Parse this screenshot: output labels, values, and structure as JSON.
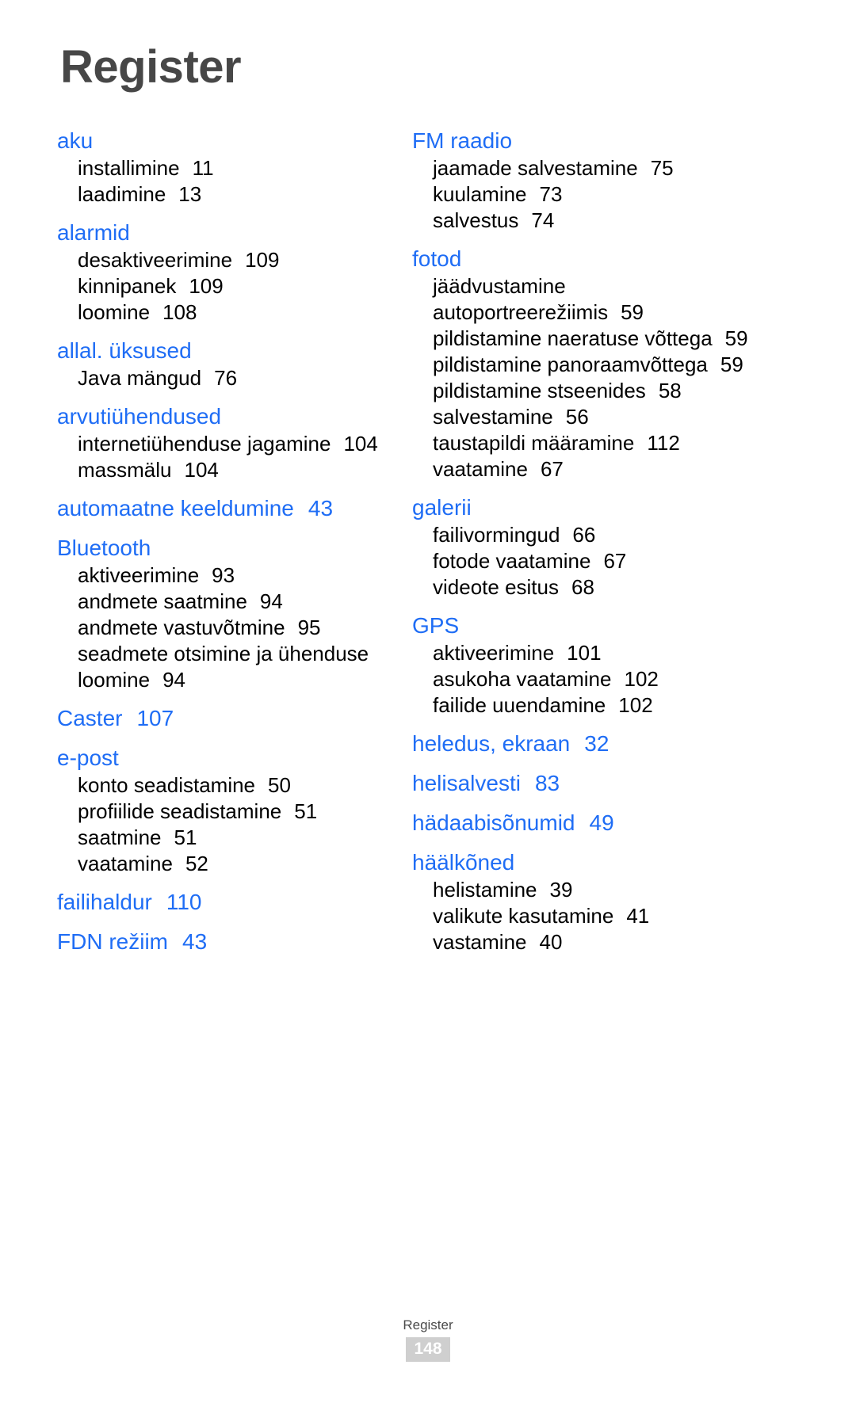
{
  "page": {
    "title": "Register",
    "footer_label": "Register",
    "footer_pagenum": "148",
    "accent_color": "#1f6df5",
    "title_color": "#474747",
    "pagenum_bg": "#cfcfcf"
  },
  "columns": [
    {
      "id": "left",
      "groups": [
        {
          "term": "aku",
          "term_page": "",
          "subs": [
            {
              "label": "installimine",
              "page": "11"
            },
            {
              "label": "laadimine",
              "page": "13"
            }
          ]
        },
        {
          "term": "alarmid",
          "term_page": "",
          "subs": [
            {
              "label": "desaktiveerimine",
              "page": "109"
            },
            {
              "label": "kinnipanek",
              "page": "109"
            },
            {
              "label": "loomine",
              "page": "108"
            }
          ]
        },
        {
          "term": "allal. üksused",
          "term_page": "",
          "subs": [
            {
              "label": "Java mängud",
              "page": "76"
            }
          ]
        },
        {
          "term": "arvutiühendused",
          "term_page": "",
          "subs": [
            {
              "label": "internetiühenduse jagamine",
              "page": "104"
            },
            {
              "label": "massmälu",
              "page": "104"
            }
          ]
        },
        {
          "term": "automaatne keeldumine",
          "term_page": "43",
          "subs": []
        },
        {
          "term": "Bluetooth",
          "term_page": "",
          "subs": [
            {
              "label": "aktiveerimine",
              "page": "93"
            },
            {
              "label": "andmete saatmine",
              "page": "94"
            },
            {
              "label": "andmete vastuvõtmine",
              "page": "95"
            },
            {
              "label": "seadmete otsimine ja ühenduse loomine",
              "page": "94"
            }
          ]
        },
        {
          "term": "Caster",
          "term_page": "107",
          "subs": []
        },
        {
          "term": "e-post",
          "term_page": "",
          "subs": [
            {
              "label": "konto seadistamine",
              "page": "50"
            },
            {
              "label": "profiilide seadistamine",
              "page": "51"
            },
            {
              "label": "saatmine",
              "page": "51"
            },
            {
              "label": "vaatamine",
              "page": "52"
            }
          ]
        },
        {
          "term": "failihaldur",
          "term_page": "110",
          "subs": []
        },
        {
          "term": "FDN režiim",
          "term_page": "43",
          "subs": []
        }
      ]
    },
    {
      "id": "right",
      "groups": [
        {
          "term": "FM raadio",
          "term_page": "",
          "subs": [
            {
              "label": "jaamade salvestamine",
              "page": "75"
            },
            {
              "label": "kuulamine",
              "page": "73"
            },
            {
              "label": "salvestus",
              "page": "74"
            }
          ]
        },
        {
          "term": "fotod",
          "term_page": "",
          "subs": [
            {
              "label": "jäädvustamine autoportreerežiimis",
              "page": "59"
            },
            {
              "label": "pildistamine naeratuse võttega",
              "page": "59"
            },
            {
              "label": "pildistamine panoraamvõttega",
              "page": "59"
            },
            {
              "label": "pildistamine stseenides",
              "page": "58"
            },
            {
              "label": "salvestamine",
              "page": "56"
            },
            {
              "label": "taustapildi määramine",
              "page": "112"
            },
            {
              "label": "vaatamine",
              "page": "67"
            }
          ]
        },
        {
          "term": "galerii",
          "term_page": "",
          "subs": [
            {
              "label": "failivormingud",
              "page": "66"
            },
            {
              "label": "fotode vaatamine",
              "page": "67"
            },
            {
              "label": "videote esitus",
              "page": "68"
            }
          ]
        },
        {
          "term": "GPS",
          "term_page": "",
          "subs": [
            {
              "label": "aktiveerimine",
              "page": "101"
            },
            {
              "label": "asukoha vaatamine",
              "page": "102"
            },
            {
              "label": "failide uuendamine",
              "page": "102"
            }
          ]
        },
        {
          "term": "heledus, ekraan",
          "term_page": "32",
          "subs": []
        },
        {
          "term": "helisalvesti",
          "term_page": "83",
          "subs": []
        },
        {
          "term": "hädaabisõnumid",
          "term_page": "49",
          "subs": []
        },
        {
          "term": "häälkõned",
          "term_page": "",
          "subs": [
            {
              "label": "helistamine",
              "page": "39"
            },
            {
              "label": "valikute kasutamine",
              "page": "41"
            },
            {
              "label": "vastamine",
              "page": "40"
            }
          ]
        }
      ]
    }
  ]
}
